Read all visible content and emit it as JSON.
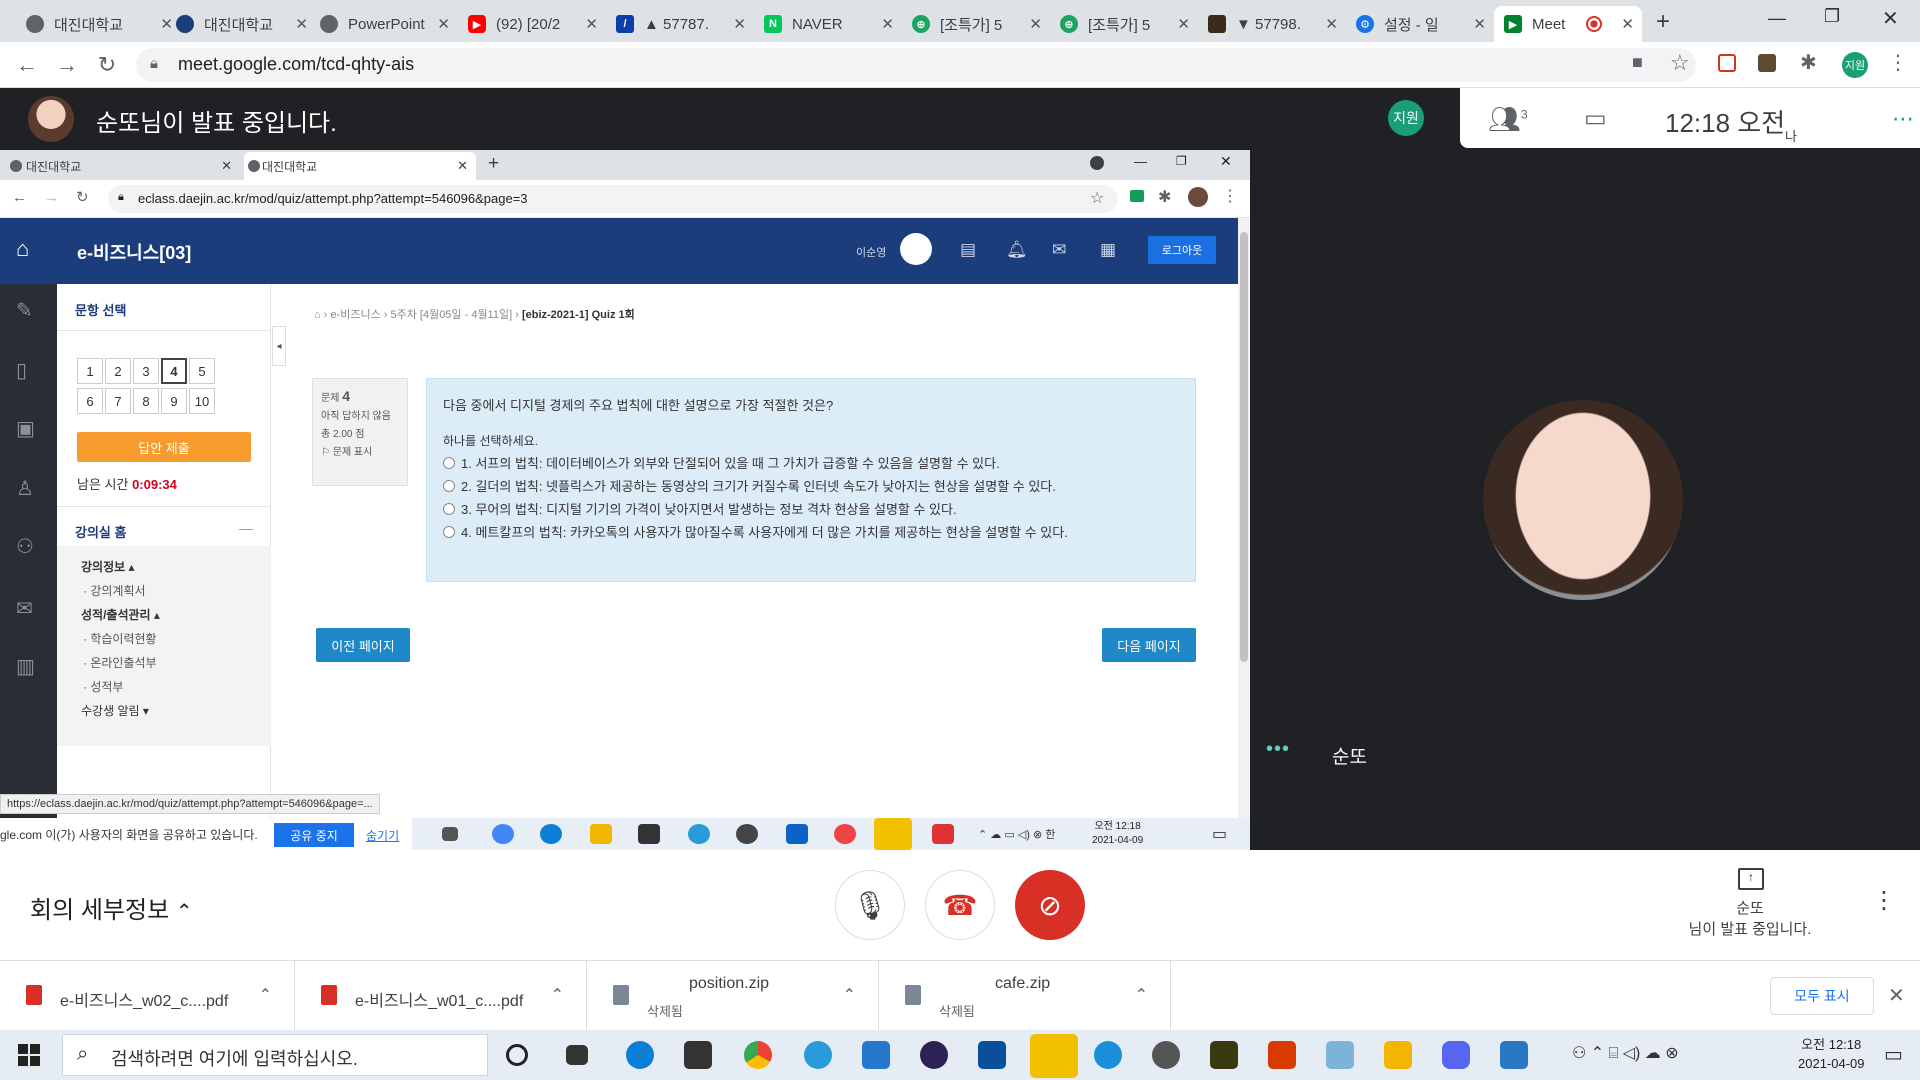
{
  "browser": {
    "tabs": [
      "대진대학교",
      "대진대학교",
      "PowerPoint",
      "(92) [20/2",
      "▲ 57787.",
      "NAVER",
      "[조특가] 5",
      "[조특가] 5",
      "▼ 57798.",
      "설정 - 일",
      "Meet"
    ],
    "url": "meet.google.com/tcd-qhty-ais"
  },
  "meet": {
    "presenting_banner": "순또님이 발표 중입니다.",
    "participants_count": "3",
    "time": "12:18 오전",
    "me_label": "나",
    "me_initials": "지원",
    "self_name": "순또",
    "meeting_details": "회의 세부정보",
    "present_label": "순또\n님이 발표 중입니다."
  },
  "shared": {
    "tabs": [
      "대진대학교",
      "대진대학교"
    ],
    "url": "eclass.daejin.ac.kr/mod/quiz/attempt.php?attempt=546096&page=3",
    "course_title": "e-비즈니스[03]",
    "user_name": "이순영",
    "logout": "로그아웃",
    "nav_title": "문항 선택",
    "question_numbers": [
      "1",
      "2",
      "3",
      "4",
      "5",
      "6",
      "7",
      "8",
      "9",
      "10"
    ],
    "submit": "답안 제출",
    "timer_label": "남은 시간",
    "timer_value": "0:09:34",
    "home_section": "강의실 홈",
    "menu": [
      "강의정보 ▴",
      "· 강의계획서",
      "성적/출석관리 ▴",
      "· 학습이력현황",
      "· 온라인출석부",
      "· 성적부",
      "수강생 알림 ▾"
    ],
    "breadcrumb": [
      "e-비즈니스",
      "5주차 [4월05일 - 4월11일]",
      "[ebiz-2021-1] Quiz 1회"
    ],
    "q_label": "문제",
    "q_number": "4",
    "q_status": "아직 답하지 않음",
    "q_points": "총 2.00 점",
    "q_flag": "문제 표시",
    "question": "다음 중에서 디지털 경제의 주요 법칙에 대한 설명으로 가장 적절한 것은?",
    "instruction": "하나를 선택하세요.",
    "options": [
      "1. 서프의 법칙: 데이터베이스가 외부와 단절되어 있을 때 그 가치가 급증할 수 있음을 설명할 수 있다.",
      "2. 길더의 법칙: 넷플릭스가 제공하는 동영상의 크기가 커질수록 인터넷 속도가 낮아지는 현상을 설명할 수 있다.",
      "3. 무어의 법칙: 디지털 기기의 가격이 낮아지면서 발생하는 정보 격차 현상을 설명할 수 있다.",
      "4. 메트칼프의 법칙: 카카오톡의 사용자가 많아질수록 사용자에게 더 많은 가치를 제공하는 현상을 설명할 수 있다."
    ],
    "prev_page": "이전 페이지",
    "next_page": "다음 페이지",
    "status_url": "https://eclass.daejin.ac.kr/mod/quiz/attempt.php?attempt=546096&page=...",
    "share_notice": "gle.com 이(가) 사용자의 화면을 공유하고 있습니다.",
    "stop_share": "공유 중지",
    "hide": "숨기기",
    "inner_time": "오전 12:18",
    "inner_date": "2021-04-09"
  },
  "downloads": [
    {
      "name": "e-비즈니스_w02_c....pdf",
      "sub": "",
      "type": "pdf"
    },
    {
      "name": "e-비즈니스_w01_c....pdf",
      "sub": "",
      "type": "pdf"
    },
    {
      "name": "position.zip",
      "sub": "삭제됨",
      "type": "zip"
    },
    {
      "name": "cafe.zip",
      "sub": "삭제됨",
      "type": "zip"
    }
  ],
  "show_all": "모두 표시",
  "taskbar": {
    "search_placeholder": "검색하려면 여기에 입력하십시오.",
    "time": "오전 12:18",
    "date": "2021-04-09"
  }
}
